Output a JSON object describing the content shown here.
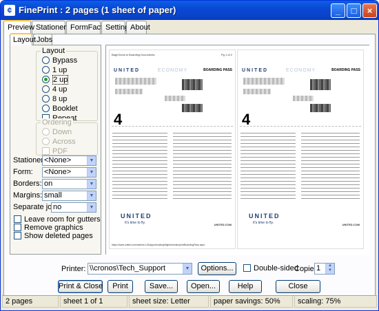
{
  "window": {
    "title": "FinePrint : 2 pages (1 sheet of paper)"
  },
  "tabs": [
    "Preview",
    "Stationery",
    "FormFactory",
    "Settings",
    "About"
  ],
  "subtabs": [
    "Layout",
    "Jobs"
  ],
  "layout_group": {
    "label": "Layout",
    "options": [
      "Bypass",
      "1 up",
      "2 up",
      "4 up",
      "8 up",
      "Booklet"
    ],
    "selected": "2 up",
    "repeat_label": "Repeat"
  },
  "ordering_group": {
    "label": "Ordering",
    "options": [
      "Down",
      "Across"
    ],
    "pdf_label": "PDF"
  },
  "fields": {
    "stationery": {
      "label": "Stationery:",
      "value": "<None>"
    },
    "form": {
      "label": "Form:",
      "value": "<None>"
    },
    "borders": {
      "label": "Borders:",
      "value": "on"
    },
    "margins": {
      "label": "Margins:",
      "value": "small"
    },
    "separate_jobs": {
      "label": "Separate jobs:",
      "value": "no"
    }
  },
  "checks": [
    "Leave room for gutters",
    "Remove graphics",
    "Show deleted pages"
  ],
  "preview": {
    "doc_title": "Bag/Check-in Boarding Documents",
    "page": "Pg 1 of 2",
    "united": "UNITED",
    "economy": "ECONOMY",
    "boarding_pass": "BOARDING PASS",
    "big": "4",
    "united2": "UNITED",
    "fly": "It's time to fly.",
    "unitedcom": "UNITED.COM",
    "url": "https://www.united.com/web/en-US/apps/booking/flight/checkin/printBoardingPass.aspx"
  },
  "printer": {
    "label": "Printer:",
    "value": "\\\\cronos\\Tech_Support",
    "options_button": "Options...",
    "double_sided": "Double-sided",
    "copies_label": "Copies:",
    "copies": "1"
  },
  "buttons": [
    "Print & Close",
    "Print",
    "Save...",
    "Open...",
    "Help",
    "Close"
  ],
  "status": [
    "2 pages",
    "sheet 1 of 1",
    "sheet size: Letter",
    "paper savings: 50%",
    "scaling: 75%"
  ]
}
